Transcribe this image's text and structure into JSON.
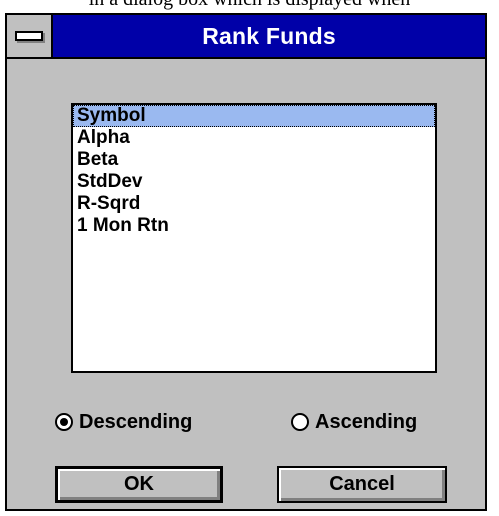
{
  "caption": {
    "text": "in a dialog box which is displayed when"
  },
  "dialog": {
    "title": "Rank Funds",
    "list": {
      "items": [
        "Symbol",
        "Alpha",
        "Beta",
        "StdDev",
        "R-Sqrd",
        "1 Mon Rtn"
      ],
      "selected_index": 0
    },
    "sort_order": {
      "options": [
        {
          "label": "Descending",
          "checked": true
        },
        {
          "label": "Ascending",
          "checked": false
        }
      ]
    },
    "buttons": {
      "ok_label": "OK",
      "cancel_label": "Cancel"
    }
  },
  "colors": {
    "title_bar": "#0000a8",
    "dialog_face": "#c0c0c0",
    "selection": "#9ab9f0"
  }
}
